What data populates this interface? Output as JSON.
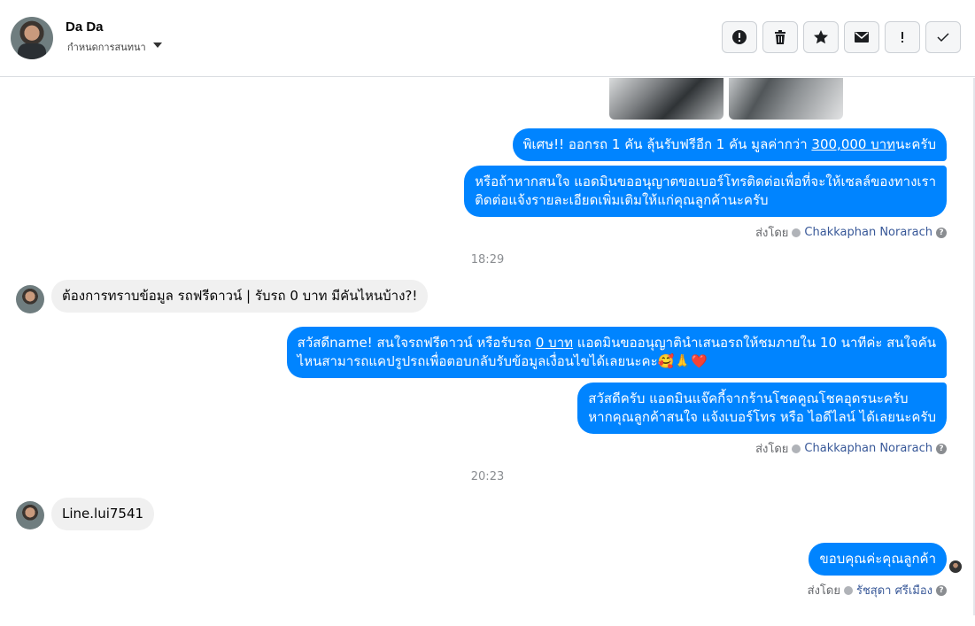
{
  "header": {
    "contact_name": "Da Da",
    "assign_label": "กำหนดการสนทนา",
    "toolbar": [
      {
        "name": "spam-button",
        "icon": "alert-circle-icon"
      },
      {
        "name": "delete-button",
        "icon": "trash-icon"
      },
      {
        "name": "star-button",
        "icon": "star-icon"
      },
      {
        "name": "mark-unread-button",
        "icon": "envelope-icon"
      },
      {
        "name": "follow-up-button",
        "icon": "exclamation-icon"
      },
      {
        "name": "mark-done-button",
        "icon": "check-icon"
      }
    ]
  },
  "messages": {
    "m1": {
      "prefix": "พิเศษ!! ออกรถ 1 คัน ลุ้นรับฟรีอีก 1 คัน มูลค่ากว่า ",
      "link": "300,000 บาท",
      "suffix": "นะครับ"
    },
    "m2": {
      "line1": "หรือถ้าหากสนใจ แอดมินขออนุญาตขอเบอร์โทรติดต่อเพื่อที่จะให้เซลล์ของทางเรา",
      "line2": "ติดต่อแจ้งรายละเอียดเพิ่มเติมให้แก่คุณลูกค้านะครับ"
    },
    "sent_by_1": {
      "label": "ส่งโดย",
      "name": "Chakkaphan Norarach"
    },
    "time_1": "18:29",
    "m3": "ต้องการทราบข้อมูล รถฟรีดาวน์ | รับรถ 0 บาท มีคันไหนบ้าง?!",
    "m4": {
      "prefix": "สวัสดีname! สนใจรถฟรีดาวน์ หรือรับรถ ",
      "link": "0 บาท",
      "middle": " แอดมินขออนุญาตินำเสนอรถให้ชมภายใน 10 นาทีค่ะ สนใจคัน",
      "line2": "ไหนสามารถแคปรูปรถเพื่อตอบกลับรับข้อมูลเงื่อนไขได้เลยนะคะ",
      "emoji": "🥰🙏❤️"
    },
    "m5": {
      "line1": "สวัสดีครับ แอดมินแจ๊คกี้จากร้านโชคคูณโชคอุดรนะครับ",
      "line2": "หากคุณลูกค้าสนใจ แจ้งเบอร์โทร หรือ ไอดีไลน์ ได้เลยนะครับ"
    },
    "sent_by_2": {
      "label": "ส่งโดย",
      "name": "Chakkaphan Norarach"
    },
    "time_2": "20:23",
    "m6": "Line.lui7541",
    "m7": "ขอบคุณค่ะคุณลูกค้า",
    "sent_by_3": {
      "label": "ส่งโดย",
      "name": "รัชสุดา ศรีเมือง"
    }
  },
  "colors": {
    "outgoing": "#0084ff",
    "incoming": "#f0f0f0"
  }
}
